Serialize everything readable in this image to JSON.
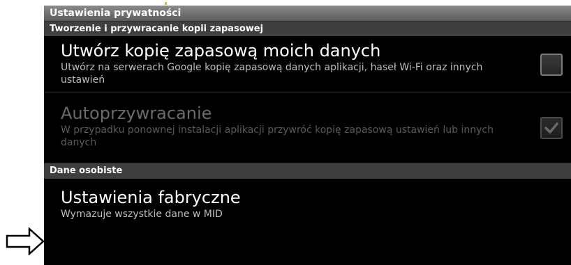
{
  "window": {
    "title": "Ustawienia prywatności"
  },
  "sections": {
    "backup": {
      "header": "Tworzenie i przywracanie kopii zapasowej"
    },
    "personal": {
      "header": "Dane osobiste"
    }
  },
  "prefs": {
    "backup_data": {
      "title": "Utwórz kopię zapasową moich danych",
      "summary": "Utwórz na serwerach Google kopię zapasową danych aplikacji, haseł Wi-Fi oraz innych ustawień",
      "checked": false,
      "enabled": true
    },
    "auto_restore": {
      "title": "Autoprzywracanie",
      "summary": "W przypadku ponownej instalacji aplikacji przywróć kopię zapasową ustawień lub innych danych",
      "checked": true,
      "enabled": false
    },
    "factory_reset": {
      "title": "Ustawienia fabryczne",
      "summary": "Wymazuje wszystkie dane w MID"
    }
  },
  "annotation": {
    "icon": "right-arrow-icon"
  },
  "colors": {
    "background": "#000000",
    "titlebar": "#6f6f6f",
    "section_header": "#3f3f3f",
    "text_primary": "#ffffff",
    "text_secondary": "#bdbdbd",
    "text_disabled": "#6b6b6b"
  }
}
